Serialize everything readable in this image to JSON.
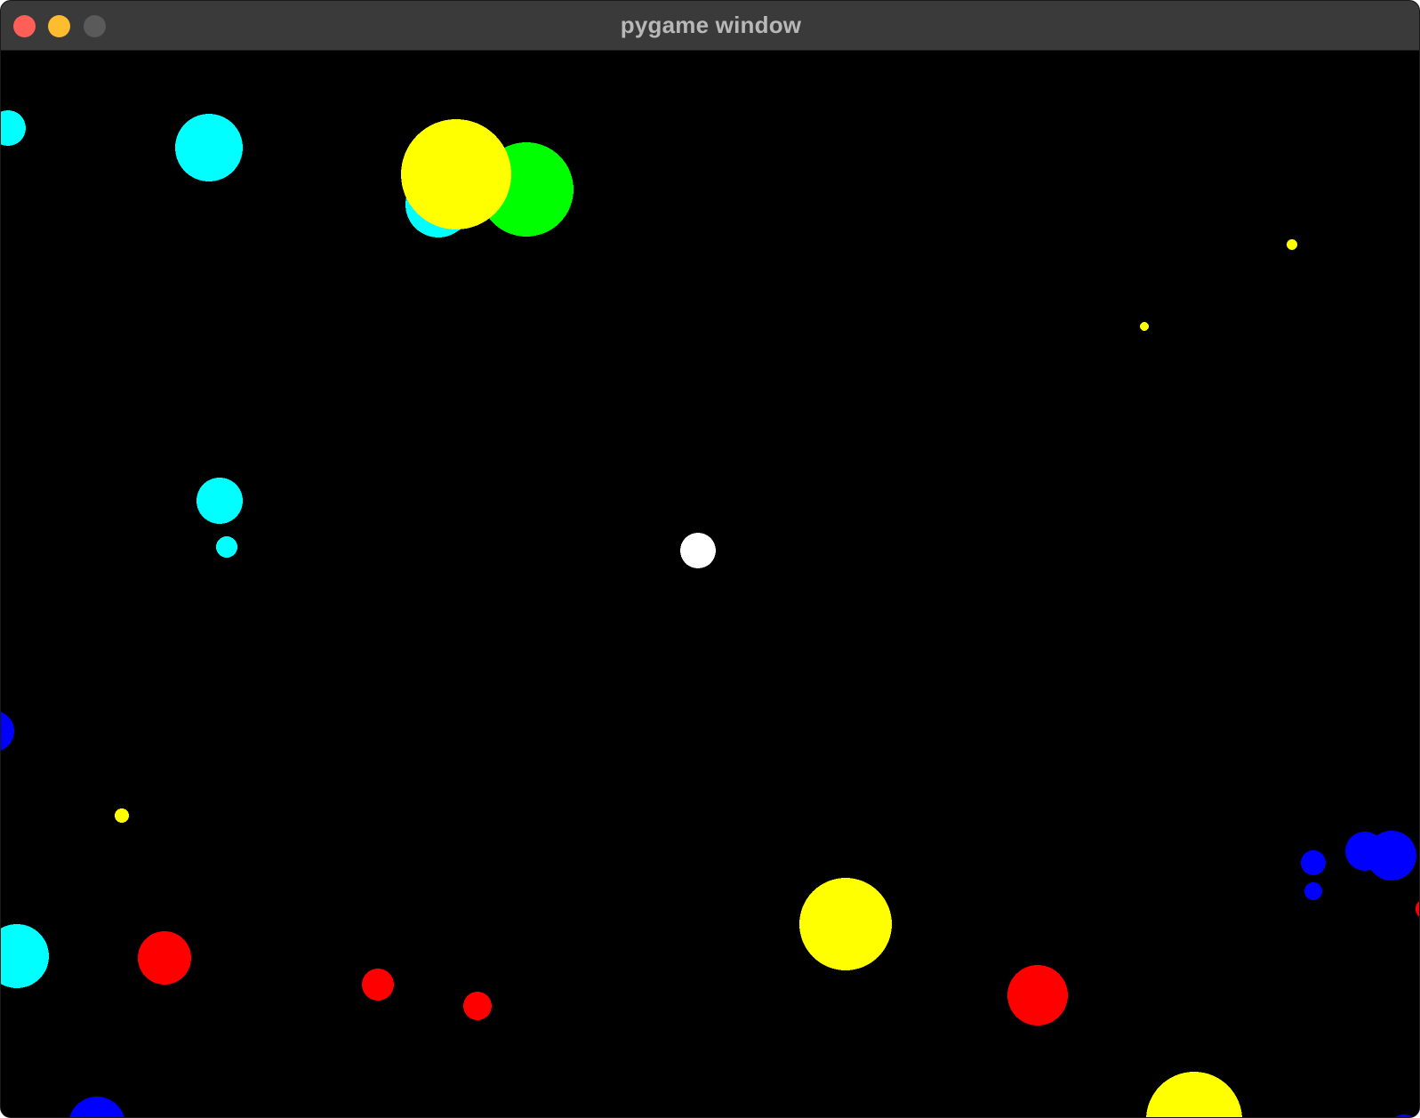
{
  "window": {
    "title": "pygame window",
    "traffic_lights": [
      {
        "name": "close",
        "color": "#ff5f57"
      },
      {
        "name": "minimize",
        "color": "#febc2e"
      },
      {
        "name": "zoom",
        "color": "#5a5a5a"
      }
    ]
  },
  "game": {
    "background": "#000000",
    "palette": {
      "cyan": "#00ffff",
      "yellow": "#ffff00",
      "green": "#00ff00",
      "white": "#ffffff",
      "blue": "#0000ff",
      "red": "#ff0000"
    },
    "player_color": "white",
    "ball_counts": {
      "cyan": 6,
      "yellow": 6,
      "green": 1,
      "white": 1,
      "blue": 6,
      "red": 6
    }
  }
}
